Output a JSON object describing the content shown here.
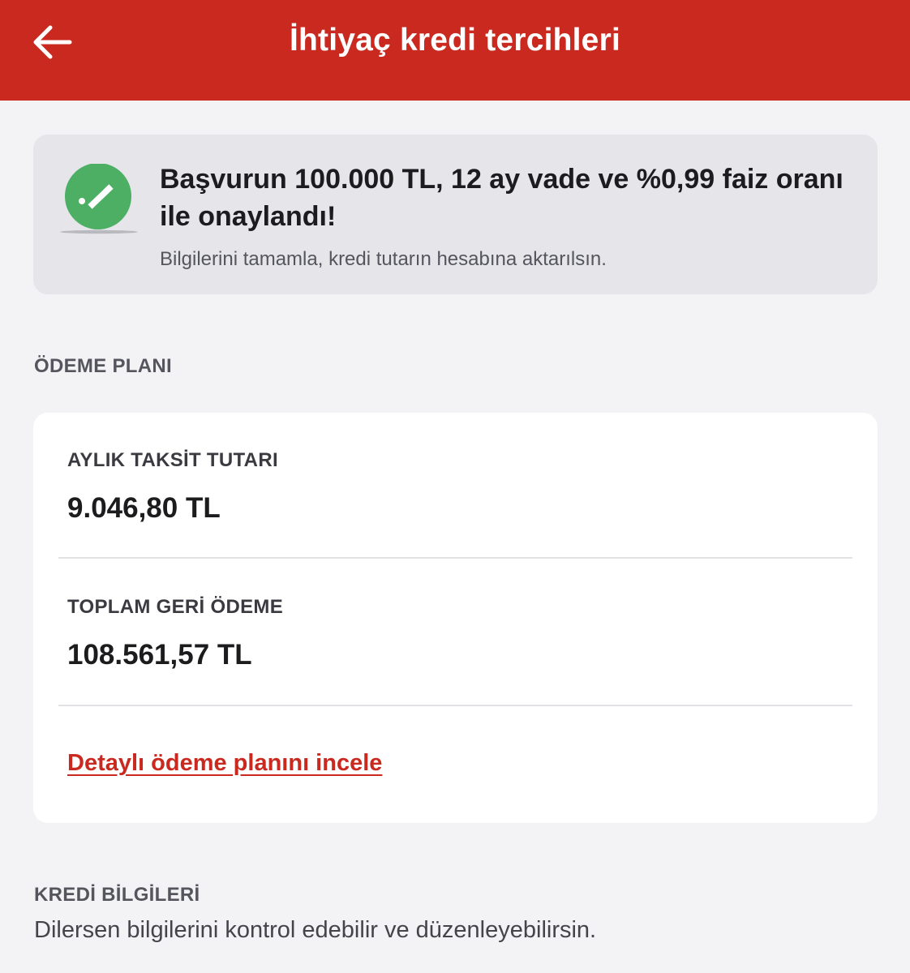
{
  "header": {
    "title": "İhtiyaç kredi tercihleri",
    "back_icon": "arrow-left-icon",
    "background_color": "#c9291f"
  },
  "status": {
    "icon": "check-circle-icon",
    "icon_color": "#4caf63",
    "title": "Başvurun 100.000 TL, 12 ay vade ve %0,99 faiz oranı ile onaylandı!",
    "subtitle": "Bilgilerini tamamla, kredi tutarın hesabına aktarılsın."
  },
  "payment_plan": {
    "section_title": "ÖDEME PLANI",
    "monthly_label": "AYLIK TAKSİT TUTARI",
    "monthly_value": "9.046,80 TL",
    "total_label": "TOPLAM GERİ ÖDEME",
    "total_value": "108.561,57 TL",
    "detail_link": "Detaylı ödeme planını incele",
    "link_color": "#c9291f"
  },
  "credit_info": {
    "section_title": "KREDİ BİLGİLERİ",
    "description": "Dilersen bilgilerini kontrol edebilir ve düzenleyebilirsin."
  }
}
